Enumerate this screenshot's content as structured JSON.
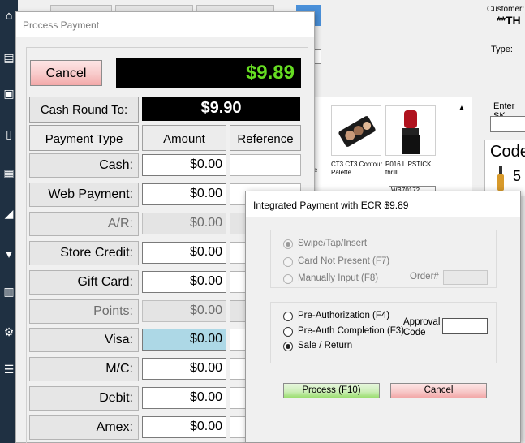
{
  "background": {
    "customer_label": "Customer:",
    "customer_value": "**TH",
    "type_label": "Type:",
    "sku_label": "Enter SK",
    "code_label": "Code",
    "code_number": "5",
    "products": [
      {
        "name": "CT3 CT3 Contour Palette"
      },
      {
        "name": "P016 LIPSTICK thrill"
      }
    ],
    "side_text": "se",
    "wb_text": "WB70172",
    "blue_tab_text": "p"
  },
  "process_payment": {
    "title": "Process Payment",
    "cancel_label": "Cancel",
    "total": "$9.89",
    "cash_round_label": "Cash Round To:",
    "cash_round_value": "$9.90",
    "headers": {
      "type": "Payment Type",
      "amount": "Amount",
      "reference": "Reference"
    },
    "rows": [
      {
        "label": "Cash:",
        "amount": "$0.00",
        "state": "normal"
      },
      {
        "label": "Web Payment:",
        "amount": "$0.00",
        "state": "normal"
      },
      {
        "label": "A/R:",
        "amount": "$0.00",
        "state": "disabled"
      },
      {
        "label": "Store Credit:",
        "amount": "$0.00",
        "state": "normal"
      },
      {
        "label": "Gift Card:",
        "amount": "$0.00",
        "state": "normal"
      },
      {
        "label": "Points:",
        "amount": "$0.00",
        "state": "disabled"
      },
      {
        "label": "Visa:",
        "amount": "$0.00",
        "state": "highlight"
      },
      {
        "label": "M/C:",
        "amount": "$0.00",
        "state": "normal"
      },
      {
        "label": "Debit:",
        "amount": "$0.00",
        "state": "normal"
      },
      {
        "label": "Amex:",
        "amount": "$0.00",
        "state": "normal"
      }
    ]
  },
  "integrated_payment": {
    "title": "Integrated Payment with ECR $9.89",
    "entry_options": [
      {
        "label": "Swipe/Tap/Insert",
        "selected": true
      },
      {
        "label": "Card Not Present  (F7)",
        "selected": false
      },
      {
        "label": "Manually Input  (F8)",
        "selected": false
      }
    ],
    "order_label": "Order#",
    "transaction_options": [
      {
        "label": "Pre-Authorization (F4)",
        "selected": false
      },
      {
        "label": "Pre-Auth Completion (F3)",
        "selected": false
      },
      {
        "label": "Sale / Return",
        "selected": true
      }
    ],
    "approval_label_line1": "Approval",
    "approval_label_line2": "Code",
    "process_label": "Process (F10)",
    "cancel_label": "Cancel"
  }
}
